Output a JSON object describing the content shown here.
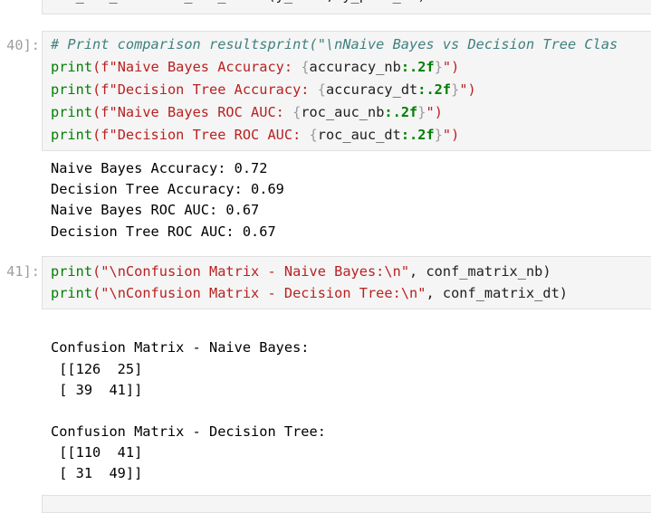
{
  "cell39": {
    "partial_line": "roc_auc_dt = roc_auc_score(y_test, y_pred_dt)"
  },
  "cell40": {
    "prompt": "40]:",
    "code": {
      "comment": "# Print comparison resultsprint(\"\\nNaive Bayes vs Decision Tree Clas",
      "l1_print": "print",
      "l1_str_a": "(f\"Naive Bayes Accuracy: ",
      "l1_brace_open": "{",
      "l1_var": "accuracy_nb",
      "l1_fmt": ":.2f",
      "l1_brace_close": "}",
      "l1_str_b": "\")",
      "l2_print": "print",
      "l2_str_a": "(f\"Decision Tree Accuracy: ",
      "l2_brace_open": "{",
      "l2_var": "accuracy_dt",
      "l2_fmt": ":.2f",
      "l2_brace_close": "}",
      "l2_str_b": "\")",
      "l3_print": "print",
      "l3_str_a": "(f\"Naive Bayes ROC AUC: ",
      "l3_brace_open": "{",
      "l3_var": "roc_auc_nb",
      "l3_fmt": ":.2f",
      "l3_brace_close": "}",
      "l3_str_b": "\")",
      "l4_print": "print",
      "l4_str_a": "(f\"Decision Tree ROC AUC: ",
      "l4_brace_open": "{",
      "l4_var": "roc_auc_dt",
      "l4_fmt": ":.2f",
      "l4_brace_close": "}",
      "l4_str_b": "\")"
    },
    "output": [
      "Naive Bayes Accuracy: 0.72",
      "Decision Tree Accuracy: 0.69",
      "Naive Bayes ROC AUC: 0.67",
      "Decision Tree ROC AUC: 0.67"
    ]
  },
  "cell41": {
    "prompt": "41]:",
    "code": {
      "l1_print": "print",
      "l1_str": "(\"\\nConfusion Matrix - Naive Bayes:\\n\"",
      "l1_rest": ", conf_matrix_nb)",
      "l2_print": "print",
      "l2_str": "(\"\\nConfusion Matrix - Decision Tree:\\n\"",
      "l2_rest": ", conf_matrix_dt)"
    },
    "output": [
      "Confusion Matrix - Naive Bayes:",
      " [[126  25]",
      " [ 39  41]]",
      "Confusion Matrix - Decision Tree:",
      " [[110  41]",
      " [ 31  49]]"
    ]
  }
}
